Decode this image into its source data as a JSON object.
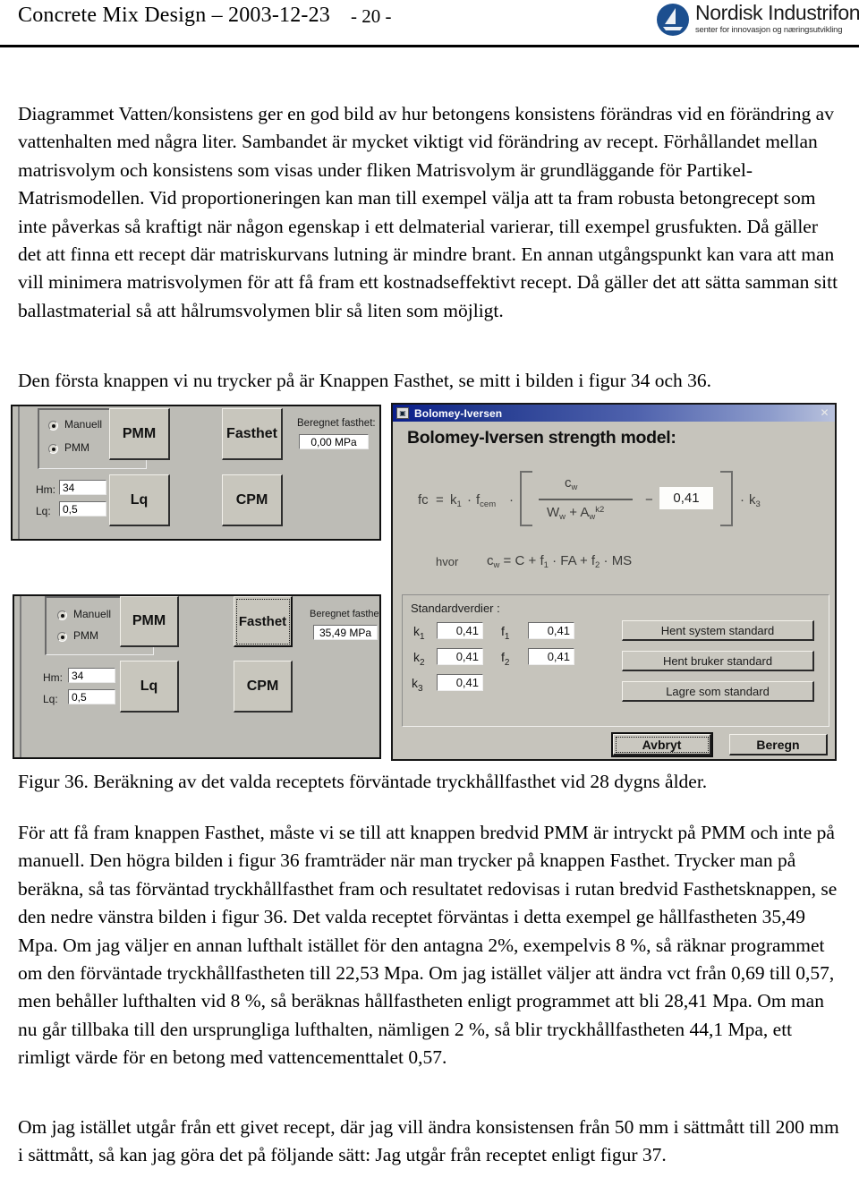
{
  "header": {
    "title": "Concrete Mix Design – 2003-12-23",
    "page_number": "- 20 -",
    "logo": {
      "icon": "nordisk-sail-logo",
      "name": "Nordisk Industrifond",
      "tagline": "senter for innovasjon og næringsutvikling"
    }
  },
  "body": {
    "paragraph_1": "Diagrammet Vatten/konsistens ger en god bild av hur betongens konsistens förändras vid en förändring av vattenhalten med några liter. Sambandet är mycket viktigt vid förändring av recept. Förhållandet mellan matrisvolym och konsistens som visas under fliken Matrisvolym är grundläggande för Partikel-Matrismodellen. Vid proportioneringen kan man till exempel välja att ta fram robusta betongrecept som inte påverkas så kraftigt när någon egenskap i ett delmaterial varierar, till exempel grusfukten. Då gäller det att finna ett recept där matriskurvans lutning är mindre brant. En annan utgångspunkt kan vara att man vill minimera matrisvolymen för att få fram ett kostnadseffektivt recept. Då gäller det att sätta samman sitt ballastmaterial så att hålrumsvolymen blir så liten som möjligt.",
    "paragraph_2": "Den första knappen vi nu trycker på är Knappen Fasthet, se mitt i bilden i figur 34 och 36.",
    "figure_caption": "Figur 36. Beräkning av det valda receptets förväntade tryckhållfasthet vid 28 dygns ålder.",
    "paragraph_3": "För att få fram knappen Fasthet, måste vi se till att knappen bredvid PMM är intryckt på PMM och inte på manuell. Den högra bilden i figur 36 framträder när man trycker på knappen Fasthet. Trycker man på beräkna, så tas förväntad tryckhållfasthet fram och resultatet redovisas i rutan bredvid Fasthetsknappen, se den nedre vänstra bilden i figur 36. Det valda receptet förväntas i detta exempel ge hållfastheten 35,49 Mpa. Om jag väljer en annan lufthalt istället för den antagna 2%, exempelvis 8 %, så räknar programmet om den förväntade tryckhållfastheten till 22,53 Mpa. Om jag istället väljer att ändra vct från 0,69 till 0,57, men behåller lufthalten vid 8 %, så beräknas hållfastheten enligt programmet att bli 28,41 Mpa. Om man nu går tillbaka till den ursprungliga lufthalten, nämligen 2 %, så blir tryckhållfastheten 44,1 Mpa, ett rimligt värde för en betong med vattencementtalet 0,57.",
    "paragraph_4": "Om jag istället utgår från ett givet recept, där jag vill ändra konsistensen från 50 mm i sättmått till 200 mm i sättmått, så kan jag göra det på följande sätt: Jag utgår från receptet enligt figur 37."
  },
  "screenshot_top_left": {
    "radio_manuell": "Manuell",
    "radio_pmm": "PMM",
    "selected_radio": "PMM",
    "button_pmm": "PMM",
    "button_lq": "Lq",
    "button_fasthet": "Fasthet",
    "button_cpm": "CPM",
    "label_hm": "Hm:",
    "value_hm": "34",
    "label_lq": "Lq:",
    "value_lq": "0,5",
    "label_result": "Beregnet fasthet:",
    "value_result": "0,00 MPa"
  },
  "screenshot_bottom_left": {
    "radio_manuell": "Manuell",
    "radio_pmm": "PMM",
    "selected_radio": "PMM",
    "button_pmm": "PMM",
    "button_lq": "Lq",
    "button_fasthet": "Fasthet",
    "button_cpm": "CPM",
    "label_hm": "Hm:",
    "value_hm": "34",
    "label_lq": "Lq:",
    "value_lq": "0,5",
    "label_result": "Beregnet fasthet:",
    "value_result": "35,49 MPa"
  },
  "dialog_bolomey": {
    "titlebar_title": "Bolomey-Iversen",
    "titlebar_icon": "app-icon",
    "close_icon": "close-icon",
    "heading": "Bolomey-Iversen strength model:",
    "formula": {
      "lhs": "fc",
      "eq": "=",
      "k1": "k",
      "k1_sub": "1",
      "dot1": "·",
      "fcem": "f",
      "fcem_sub": "cem",
      "dot2": "·",
      "numerator": "c",
      "numerator_sub": "w",
      "denominator": "W",
      "denominator_sub": "w",
      "plus": "+",
      "den2": "A",
      "den2_sub": "w",
      "den2_sup": "k2",
      "minus": "−",
      "highlight_value": "0,41",
      "dot3": "·",
      "k3": "k",
      "k3_sub": "3",
      "where_label": "hvor",
      "where_lhs": "c",
      "where_lhs_sub": "w",
      "where_eq": "=",
      "where_c": "C",
      "where_plus1": "+",
      "where_f1": "f",
      "where_f1_sub": "1",
      "where_dot1": "·",
      "where_fa": "FA",
      "where_plus2": "+",
      "where_f2": "f",
      "where_f2_sub": "2",
      "where_dot2": "·",
      "where_ms": "MS"
    },
    "standard_group_title": "Standardverdier :",
    "coefficients": [
      {
        "label": "k",
        "sub": "1",
        "value": "0,41"
      },
      {
        "label": "k",
        "sub": "2",
        "value": "0,41"
      },
      {
        "label": "k",
        "sub": "3",
        "value": "0,41"
      },
      {
        "label": "f",
        "sub": "1",
        "value": "0,41"
      },
      {
        "label": "f",
        "sub": "2",
        "value": "0,41"
      }
    ],
    "button_hent_system": "Hent system standard",
    "button_hent_bruker": "Hent bruker standard",
    "button_lagre": "Lagre som standard",
    "button_avbryt": "Avbryt",
    "button_beregn": "Beregn"
  }
}
